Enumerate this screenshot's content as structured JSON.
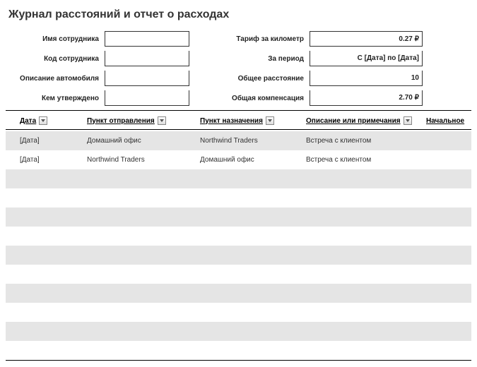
{
  "title": "Журнал расстояний и отчет о расходах",
  "header": {
    "left": [
      {
        "label": "Имя сотрудника",
        "value": ""
      },
      {
        "label": "Код сотрудника",
        "value": ""
      },
      {
        "label": "Описание автомобиля",
        "value": ""
      },
      {
        "label": "Кем утверждено",
        "value": ""
      }
    ],
    "right": [
      {
        "label": "Тариф за километр",
        "value": "0.27 ₽"
      },
      {
        "label": "За период",
        "value": "С [Дата] по [Дата]"
      },
      {
        "label": "Общее расстояние",
        "value": "10"
      },
      {
        "label": "Общая компенсация",
        "value": "2.70 ₽"
      }
    ]
  },
  "table": {
    "columns": [
      "Дата",
      "Пункт отправления",
      "Пункт назначения",
      "Описание или примечания",
      "Начальное"
    ],
    "rows": [
      {
        "date": "[Дата]",
        "from": "Домашний офис",
        "to": "Northwind Traders",
        "desc": "Встреча с клиентом"
      },
      {
        "date": "[Дата]",
        "from": "Northwind Traders",
        "to": "Домашний офис",
        "desc": "Встреча с клиентом"
      }
    ]
  }
}
